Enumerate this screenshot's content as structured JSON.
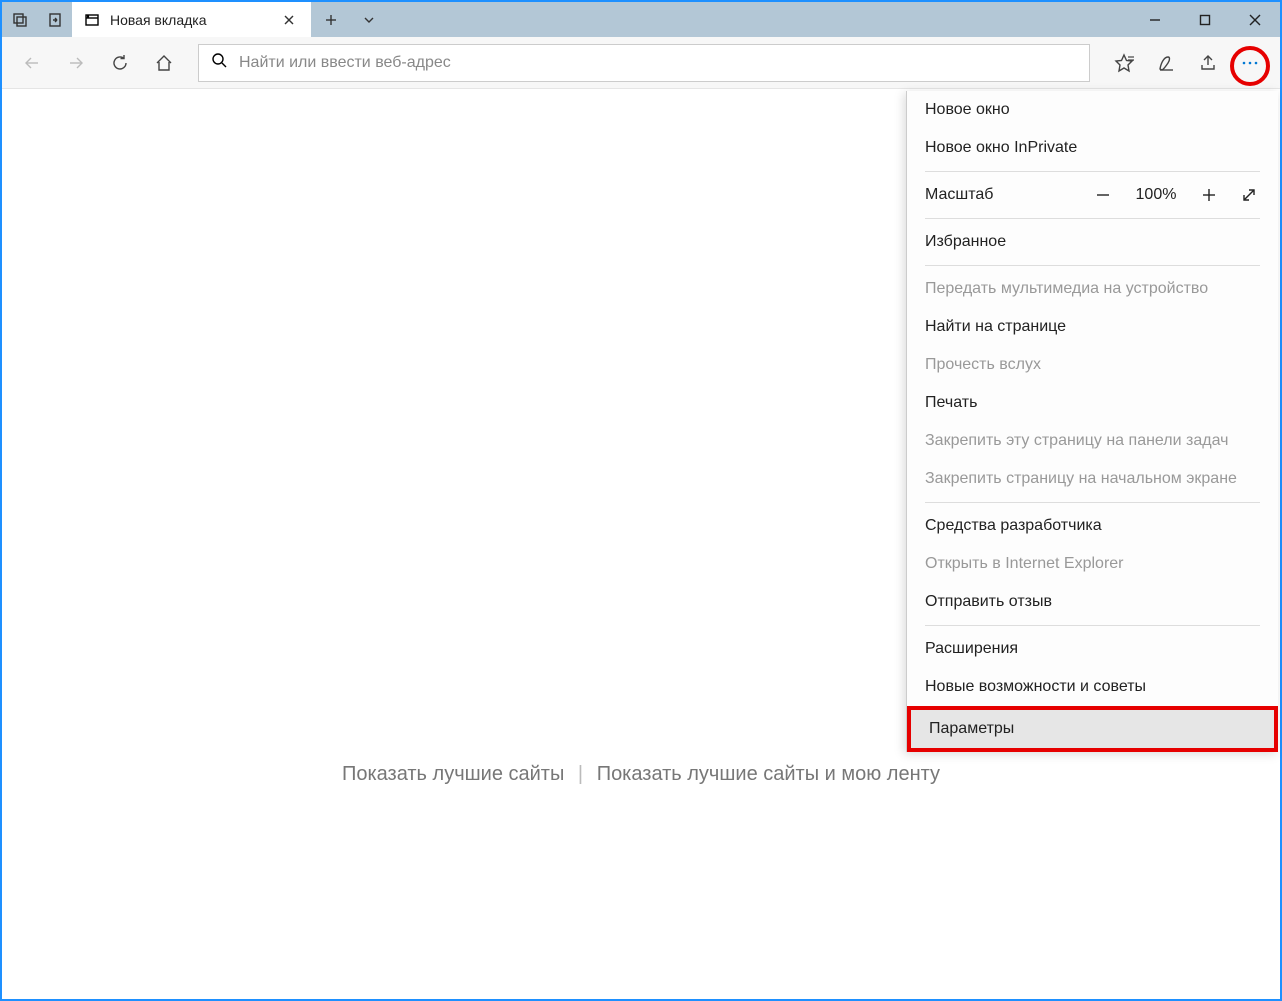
{
  "tab": {
    "title": "Новая вкладка"
  },
  "addressbar": {
    "placeholder": "Найти или ввести веб-адрес"
  },
  "content": {
    "show_top_sites": "Показать лучшие сайты",
    "separator": "|",
    "show_top_sites_feed": "Показать лучшие сайты и мою ленту"
  },
  "menu": {
    "new_window": "Новое окно",
    "new_inprivate": "Новое окно InPrivate",
    "zoom_label": "Масштаб",
    "zoom_value": "100%",
    "favorites": "Избранное",
    "cast": "Передать мультимедиа на устройство",
    "find": "Найти на странице",
    "read_aloud": "Прочесть вслух",
    "print": "Печать",
    "pin_taskbar": "Закрепить эту страницу на панели задач",
    "pin_start": "Закрепить страницу на начальном экране",
    "devtools": "Средства разработчика",
    "open_ie": "Открыть в Internet Explorer",
    "feedback": "Отправить отзыв",
    "extensions": "Расширения",
    "whatsnew": "Новые возможности и советы",
    "settings": "Параметры"
  }
}
